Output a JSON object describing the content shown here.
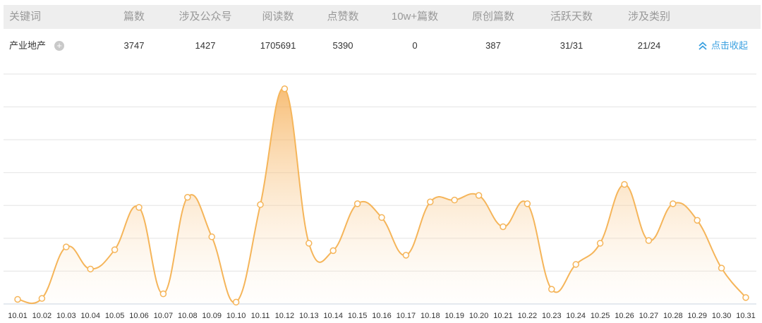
{
  "table": {
    "headers": [
      "关键词",
      "篇数",
      "涉及公众号",
      "阅读数",
      "点赞数",
      "10w+篇数",
      "原创篇数",
      "活跃天数",
      "涉及类别"
    ],
    "row": {
      "keyword": "产业地产",
      "plus_icon": "plus-circle-icon",
      "values": [
        "3747",
        "1427",
        "1705691",
        "5390",
        "0",
        "387",
        "31/31",
        "21/24"
      ]
    },
    "collapse_label": "点击收起",
    "collapse_icon": "double-chevron-up-icon"
  },
  "colors": {
    "header_bg": "#eeeeee",
    "header_text": "#999999",
    "line": "#f5b55a",
    "link": "#3aa0e0"
  },
  "chart_data": {
    "type": "area",
    "x": [
      "10.01",
      "10.02",
      "10.03",
      "10.04",
      "10.05",
      "10.06",
      "10.07",
      "10.08",
      "10.09",
      "10.10",
      "10.11",
      "10.12",
      "10.13",
      "10.14",
      "10.15",
      "10.16",
      "10.17",
      "10.18",
      "10.19",
      "10.20",
      "10.21",
      "10.22",
      "10.23",
      "10.24",
      "10.25",
      "10.26",
      "10.27",
      "10.28",
      "10.29",
      "10.30",
      "10.31"
    ],
    "series": [
      {
        "values": [
          5,
          6,
          62,
          38,
          59,
          105,
          11,
          116,
          73,
          2,
          108,
          234,
          66,
          58,
          109,
          94,
          53,
          111,
          113,
          118,
          84,
          109,
          16,
          43,
          66,
          130,
          69,
          109,
          91,
          39,
          7
        ]
      }
    ],
    "ylim": [
      0,
      250
    ],
    "y_gridlines": 7,
    "grid": true,
    "legend": "none"
  }
}
